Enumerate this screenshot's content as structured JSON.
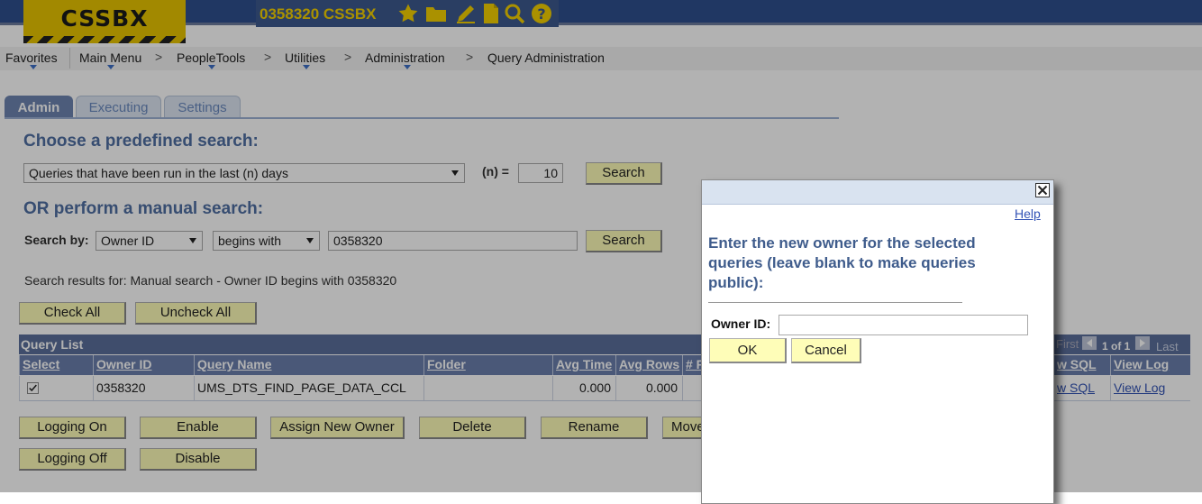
{
  "header": {
    "logo_text": "CSSBX",
    "environment": "0358320  CSSBX",
    "icons": [
      "star-icon",
      "folder-icon",
      "pencil-icon",
      "document-icon",
      "search-icon",
      "help-icon"
    ],
    "colors": {
      "banner": "#2f4f8e",
      "logo": "#e8c500",
      "env_text": "#f4d000"
    }
  },
  "breadcrumbs": {
    "items": [
      "Favorites",
      "Main Menu",
      "PeopleTools",
      "Utilities",
      "Administration",
      "Query Administration"
    ],
    "separator": ">"
  },
  "tabs": [
    {
      "label": "Admin",
      "active": true
    },
    {
      "label": "Executing",
      "active": false
    },
    {
      "label": "Settings",
      "active": false
    }
  ],
  "predefined": {
    "title": "Choose a predefined search:",
    "selected": "Queries that have been run in the last (n) days",
    "n_label": "(n) =",
    "n_value": "10",
    "search_label": "Search"
  },
  "manual": {
    "title": "OR perform a manual search:",
    "search_by_label": "Search by:",
    "field_selected": "Owner ID",
    "operator_selected": "begins with",
    "value": "0358320",
    "search_label": "Search"
  },
  "results": {
    "summary": "Search results for: Manual search - Owner ID begins with 0358320",
    "check_all": "Check All",
    "uncheck_all": "Uncheck All"
  },
  "grid": {
    "title": "Query List",
    "nav": {
      "first": "First",
      "range": "1 of 1",
      "last": "Last"
    },
    "columns": [
      "Select",
      "Owner ID",
      "Query Name",
      "Folder",
      "Avg Time",
      "Avg Rows",
      "# R",
      "w SQL",
      "View Log"
    ],
    "rows": [
      {
        "owner_id": "0358320",
        "query_name": "UMS_DTS_FIND_PAGE_DATA_CCL",
        "folder": "",
        "avg_time": "0.000",
        "avg_rows": "0.000",
        "view_sql": "w SQL",
        "view_log": "View Log",
        "selected": true
      }
    ]
  },
  "actions": {
    "row1": [
      "Logging On",
      "Enable",
      "Assign New Owner",
      "Delete",
      "Rename",
      "Move"
    ],
    "row2": [
      "Logging Off",
      "Disable"
    ]
  },
  "modal": {
    "help": "Help",
    "message": "Enter the new owner for the selected queries (leave blank to make queries public):",
    "owner_label": "Owner ID:",
    "owner_value": "",
    "ok": "OK",
    "cancel": "Cancel"
  }
}
